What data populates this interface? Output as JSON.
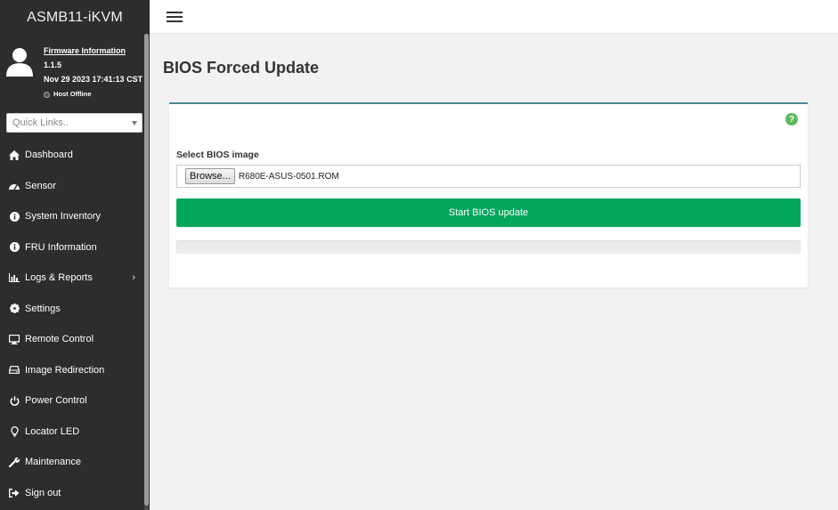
{
  "app": {
    "title": "ASMB11-iKVM"
  },
  "user_panel": {
    "firmware_link": "Firmware Information",
    "version": "1.1.5",
    "datetime": "Nov 29 2023 17:41:13 CST",
    "host_status": "Host Offline"
  },
  "quick_links": {
    "placeholder": "Quick Links.."
  },
  "sidebar": {
    "items": [
      {
        "label": "Dashboard",
        "icon": "home-icon"
      },
      {
        "label": "Sensor",
        "icon": "gauge-icon"
      },
      {
        "label": "System Inventory",
        "icon": "info-icon"
      },
      {
        "label": "FRU Information",
        "icon": "info-icon"
      },
      {
        "label": "Logs & Reports",
        "icon": "bar-chart-icon",
        "has_submenu": true
      },
      {
        "label": "Settings",
        "icon": "gear-icon"
      },
      {
        "label": "Remote Control",
        "icon": "monitor-icon"
      },
      {
        "label": "Image Redirection",
        "icon": "drive-icon"
      },
      {
        "label": "Power Control",
        "icon": "power-icon"
      },
      {
        "label": "Locator LED",
        "icon": "lightbulb-icon"
      },
      {
        "label": "Maintenance",
        "icon": "wrench-icon"
      },
      {
        "label": "Sign out",
        "icon": "sign-out-icon"
      }
    ]
  },
  "page": {
    "title": "BIOS Forced Update",
    "select_label": "Select BIOS image",
    "browse_label": "Browse...",
    "file_name": "R680E-ASUS-0501.ROM",
    "start_button": "Start BIOS update",
    "progress": 0,
    "help_icon": "?"
  },
  "colors": {
    "sidebar_bg": "#2d2d2d",
    "start_button": "#00a65a",
    "help_icon": "#5cb85c",
    "card_border": "#4a8a94"
  }
}
